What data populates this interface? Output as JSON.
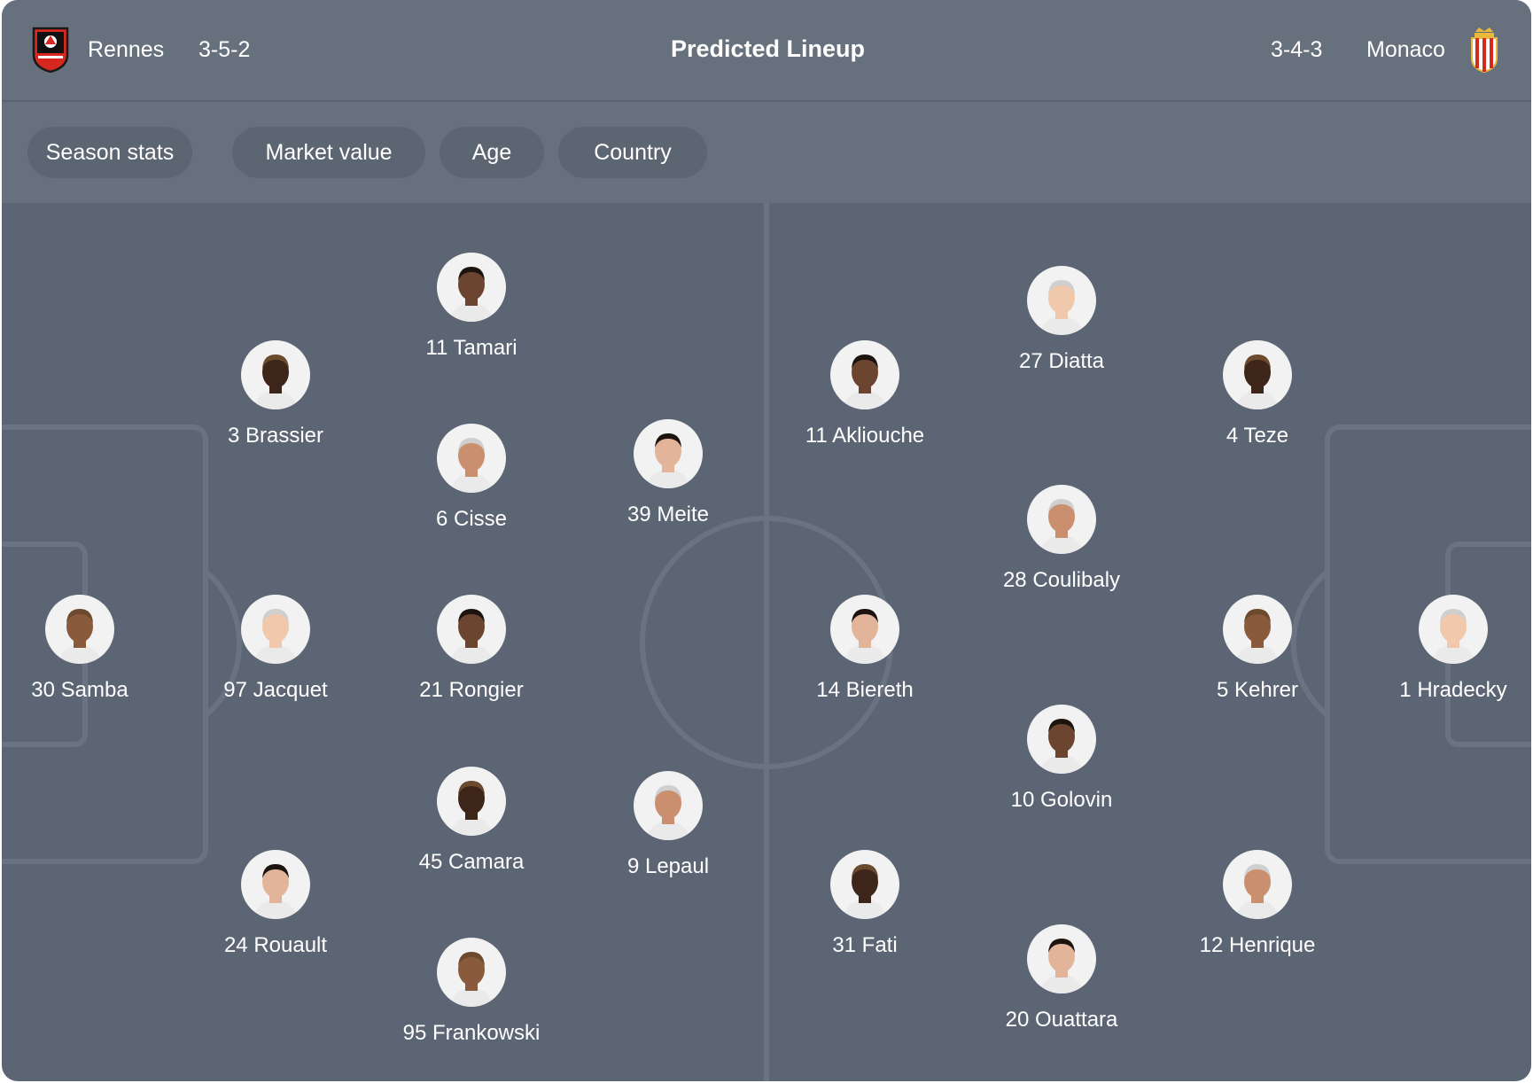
{
  "header": {
    "home_team": "Rennes",
    "home_formation": "3-5-2",
    "title": "Predicted Lineup",
    "away_formation": "3-4-3",
    "away_team": "Monaco"
  },
  "filters": [
    "Season stats",
    "Market value",
    "Age",
    "Country"
  ],
  "home_players": [
    "11 Tamari",
    "3 Brassier",
    "6 Cisse",
    "39 Meite",
    "30 Samba",
    "97 Jacquet",
    "21 Rongier",
    "45 Camara",
    "9 Lepaul",
    "24 Rouault",
    "95 Frankowski"
  ],
  "away_players": [
    "27 Diatta",
    "11 Akliouche",
    "4 Teze",
    "28 Coulibaly",
    "14 Biereth",
    "5 Kehrer",
    "1 Hradecky",
    "10 Golovin",
    "31 Fati",
    "12 Henrique",
    "20 Ouattara"
  ],
  "colors": {
    "card": "#5b6573",
    "header": "#67717e",
    "chip": "#5c6572",
    "pitch_lines": "#697382",
    "text": "#ffffff"
  }
}
